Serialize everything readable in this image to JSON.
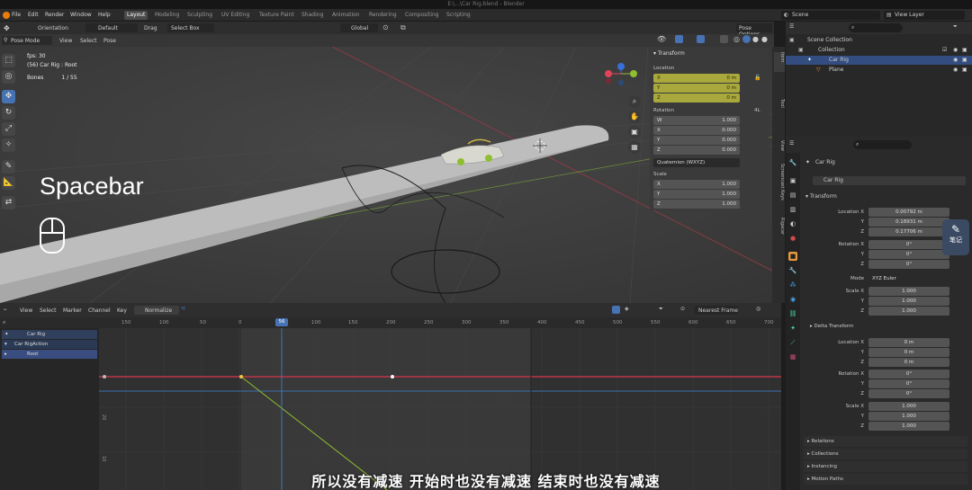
{
  "title_bar": {
    "text": "E:\\...\\Car Rig.blend - Blender"
  },
  "menu": [
    "File",
    "Edit",
    "Render",
    "Window",
    "Help"
  ],
  "workspaces": [
    "Layout",
    "Modeling",
    "Sculpting",
    "UV Editing",
    "Texture Paint",
    "Shading",
    "Animation",
    "Rendering",
    "Compositing",
    "Scripting"
  ],
  "active_workspace": "Layout",
  "top_right": {
    "scene": "Scene",
    "view_layer": "View Layer"
  },
  "viewport_header": {
    "orientation_label": "Orientation",
    "orientation_value": "Default",
    "drag_label": "Drag",
    "drag_value": "Select Box",
    "transform_orientation": "Global",
    "pose_options": "Pose Options"
  },
  "viewport_header2": {
    "mode": "Pose Mode",
    "menus": [
      "View",
      "Select",
      "Pose"
    ]
  },
  "overlay_stats": {
    "fps": "fps: 30",
    "object": "(56) Car Rig : Root",
    "bones_label": "Bones",
    "bones_value": "1 / 55"
  },
  "overlay_text": "Spacebar",
  "npanel": {
    "header": "Transform",
    "location_label": "Location",
    "location": [
      {
        "axis": "X",
        "value": "0 m"
      },
      {
        "axis": "Y",
        "value": "0 m"
      },
      {
        "axis": "Z",
        "value": "0 m"
      }
    ],
    "rotation_label": "Rotation",
    "rotation_mode_tag": "4L",
    "rotation": [
      {
        "axis": "W",
        "value": "1.000"
      },
      {
        "axis": "X",
        "value": "0.000"
      },
      {
        "axis": "Y",
        "value": "0.000"
      },
      {
        "axis": "Z",
        "value": "0.000"
      }
    ],
    "rotation_mode": "Quaternion (WXYZ)",
    "scale_label": "Scale",
    "scale": [
      {
        "axis": "X",
        "value": "1.000"
      },
      {
        "axis": "Y",
        "value": "1.000"
      },
      {
        "axis": "Z",
        "value": "1.000"
      }
    ]
  },
  "sidebar_tabs": [
    "Item",
    "Tool",
    "View",
    "Screencast Keys",
    "Rigacar"
  ],
  "outliner": {
    "items": [
      {
        "label": "Scene Collection"
      },
      {
        "label": "Collection"
      },
      {
        "label": "Car Rig"
      },
      {
        "label": "Plane"
      }
    ]
  },
  "properties": {
    "object_name": "Car Rig",
    "data_name": "Car Rig",
    "transform_header": "Transform",
    "location_x_label": "Location X",
    "location": [
      "0.00792 m",
      "0.18931 m",
      "0.17706 m"
    ],
    "rotation_x_label": "Rotation X",
    "rotation": [
      "0°",
      "0°",
      "0°"
    ],
    "mode_label": "Mode",
    "mode_value": "XYZ Euler",
    "scale_x_label": "Scale X",
    "scale": [
      "1.000",
      "1.000",
      "1.000"
    ],
    "delta_header": "Delta Transform",
    "delta_location": [
      "0 m",
      "0 m",
      "0 m"
    ],
    "delta_rotation": [
      "0°",
      "0°",
      "0°"
    ],
    "delta_scale": [
      "1.000",
      "1.000",
      "1.000"
    ],
    "axis_y": "Y",
    "axis_z": "Z",
    "collapsed_sections": [
      "Relations",
      "Collections",
      "Instancing",
      "Motion Paths"
    ]
  },
  "note_button": {
    "label": "笔记"
  },
  "graph_editor": {
    "menus": [
      "View",
      "Select",
      "Marker",
      "Channel",
      "Key"
    ],
    "normalize": "Normalize",
    "frame_mode": "Nearest Frame",
    "current_frame": "56",
    "ruler_ticks": [
      "150",
      "100",
      "50",
      "0",
      "56",
      "100",
      "150",
      "200",
      "250",
      "300",
      "350",
      "400",
      "450",
      "500",
      "550",
      "600",
      "650",
      "700"
    ],
    "side_ticks": [
      "20",
      "10"
    ],
    "channels": [
      {
        "label": "Car Rig"
      },
      {
        "label": "Car RigAction"
      },
      {
        "label": "Root"
      }
    ]
  },
  "subtitle": "所以没有减速 开始时也没有减速 结束时也没有减速",
  "colors": {
    "accent": "#4772b3",
    "yellow_field": "#a9a83d",
    "curve_red": "#d8364b",
    "curve_blue": "#3a6fb0",
    "curve_green": "#8fbf2f"
  }
}
